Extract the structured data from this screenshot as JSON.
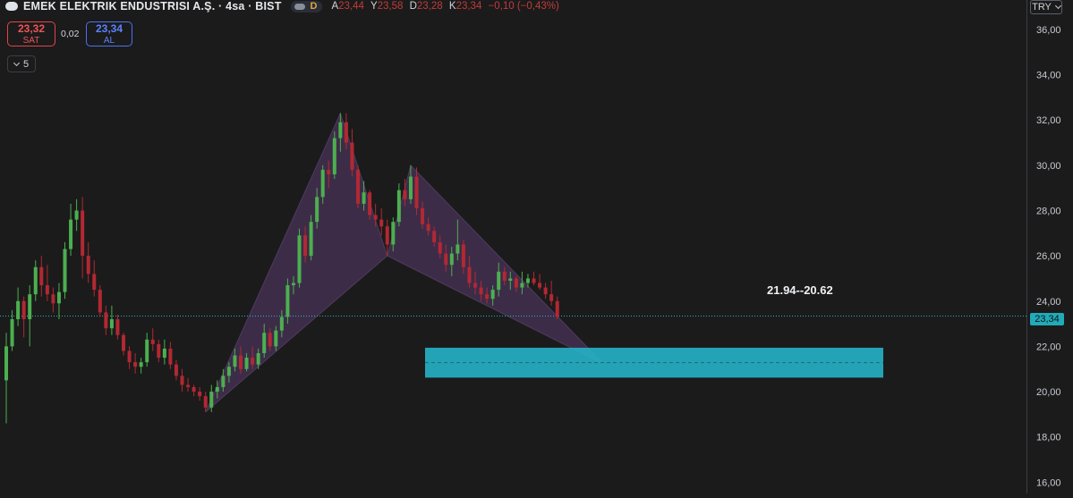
{
  "header": {
    "symbol_title": "EMEK ELEKTRIK ENDUSTRISI A.Ş. · 4sa · BIST",
    "mode_badge": "D",
    "ohlc": [
      {
        "label": "A",
        "value": "23,44"
      },
      {
        "label": "Y",
        "value": "23,58"
      },
      {
        "label": "D",
        "value": "23,28"
      },
      {
        "label": "K",
        "value": "23,34"
      },
      {
        "label": "",
        "value": "−0,10 (−0,43%)"
      }
    ]
  },
  "trade": {
    "sell_price": "23,32",
    "sell_label": "SAT",
    "spread": "0,02",
    "buy_price": "23,34",
    "buy_label": "AL"
  },
  "indicators_collapsed_count": "5",
  "currency": "TRY",
  "last_price_label": "23,34",
  "zone_label": "21.94--20.62",
  "colors": {
    "background": "#1b1b1b",
    "up": "#4caf50",
    "down": "#b22833",
    "pattern_fill": "#5a3a6e",
    "zone": "#26b3c8",
    "last_price_line": "#26b3c8"
  },
  "chart_data": {
    "type": "candlestick",
    "ylim": [
      15.5,
      37.3
    ],
    "y_ticks": [
      "16,00",
      "18,00",
      "20,00",
      "22,00",
      "24,00",
      "26,00",
      "28,00",
      "30,00",
      "32,00",
      "34,00",
      "36,00"
    ],
    "last_price": 23.34,
    "candles": [
      [
        20.5,
        22.6,
        18.6,
        22.0
      ],
      [
        22.0,
        23.6,
        21.8,
        23.2
      ],
      [
        23.2,
        24.6,
        22.9,
        24.0
      ],
      [
        24.0,
        24.2,
        22.4,
        23.2
      ],
      [
        23.2,
        24.7,
        22.0,
        24.3
      ],
      [
        24.3,
        25.8,
        24.0,
        25.5
      ],
      [
        25.5,
        26.0,
        24.2,
        24.7
      ],
      [
        24.7,
        25.6,
        24.0,
        24.3
      ],
      [
        24.3,
        24.6,
        23.5,
        23.9
      ],
      [
        23.9,
        24.8,
        23.2,
        24.4
      ],
      [
        24.4,
        26.6,
        24.1,
        26.3
      ],
      [
        26.3,
        28.3,
        26.0,
        27.6
      ],
      [
        27.6,
        28.5,
        27.1,
        28.0
      ],
      [
        28.0,
        28.6,
        25.0,
        26.0
      ],
      [
        26.0,
        26.6,
        24.8,
        25.2
      ],
      [
        25.2,
        25.8,
        24.2,
        24.5
      ],
      [
        24.5,
        24.7,
        23.3,
        23.5
      ],
      [
        23.5,
        23.8,
        22.5,
        22.8
      ],
      [
        22.8,
        23.8,
        22.5,
        23.2
      ],
      [
        23.2,
        23.4,
        22.3,
        22.5
      ],
      [
        22.5,
        22.6,
        21.6,
        21.8
      ],
      [
        21.8,
        22.0,
        21.0,
        21.3
      ],
      [
        21.3,
        21.7,
        20.8,
        21.1
      ],
      [
        21.1,
        21.5,
        20.8,
        21.3
      ],
      [
        21.3,
        22.6,
        21.1,
        22.3
      ],
      [
        22.3,
        22.8,
        21.8,
        22.1
      ],
      [
        22.1,
        22.3,
        21.3,
        21.5
      ],
      [
        21.5,
        22.3,
        21.2,
        21.9
      ],
      [
        21.9,
        22.2,
        21.0,
        21.2
      ],
      [
        21.2,
        21.4,
        20.5,
        20.7
      ],
      [
        20.7,
        21.0,
        20.0,
        20.3
      ],
      [
        20.3,
        20.6,
        20.0,
        20.2
      ],
      [
        20.2,
        20.3,
        19.8,
        20.0
      ],
      [
        20.0,
        20.2,
        19.6,
        19.8
      ],
      [
        19.8,
        20.0,
        19.1,
        19.3
      ],
      [
        19.3,
        20.3,
        19.1,
        20.0
      ],
      [
        20.0,
        20.5,
        19.7,
        20.2
      ],
      [
        20.2,
        21.0,
        20.0,
        20.7
      ],
      [
        20.7,
        21.3,
        20.4,
        21.1
      ],
      [
        21.1,
        21.9,
        20.9,
        21.6
      ],
      [
        21.6,
        22.0,
        20.8,
        21.0
      ],
      [
        21.0,
        21.7,
        20.9,
        21.5
      ],
      [
        21.5,
        22.0,
        21.0,
        21.2
      ],
      [
        21.2,
        21.9,
        21.0,
        21.7
      ],
      [
        21.7,
        23.0,
        21.5,
        22.6
      ],
      [
        22.6,
        22.8,
        21.8,
        22.0
      ],
      [
        22.0,
        22.9,
        21.8,
        22.7
      ],
      [
        22.7,
        23.6,
        22.4,
        23.3
      ],
      [
        23.3,
        25.0,
        23.0,
        24.7
      ],
      [
        24.7,
        25.1,
        24.3,
        24.8
      ],
      [
        24.8,
        27.2,
        24.6,
        26.9
      ],
      [
        26.9,
        27.3,
        25.7,
        26.0
      ],
      [
        26.0,
        27.8,
        25.8,
        27.5
      ],
      [
        27.5,
        29.0,
        27.2,
        28.6
      ],
      [
        28.6,
        30.0,
        28.3,
        29.8
      ],
      [
        29.8,
        30.2,
        29.0,
        29.6
      ],
      [
        29.6,
        31.5,
        29.4,
        31.2
      ],
      [
        31.2,
        32.3,
        30.6,
        31.9
      ],
      [
        31.9,
        32.3,
        30.7,
        31.0
      ],
      [
        31.0,
        31.6,
        29.5,
        29.8
      ],
      [
        29.8,
        30.0,
        28.1,
        28.3
      ],
      [
        28.3,
        29.3,
        28.0,
        28.8
      ],
      [
        28.8,
        28.9,
        27.6,
        27.8
      ],
      [
        27.8,
        28.3,
        27.3,
        27.6
      ],
      [
        27.6,
        28.1,
        26.9,
        27.3
      ],
      [
        27.3,
        27.6,
        26.0,
        26.5
      ],
      [
        26.5,
        27.7,
        26.2,
        27.5
      ],
      [
        27.5,
        29.2,
        27.3,
        28.9
      ],
      [
        28.9,
        29.4,
        28.2,
        28.5
      ],
      [
        28.5,
        30.0,
        28.3,
        29.5
      ],
      [
        29.5,
        29.9,
        27.8,
        28.1
      ],
      [
        28.1,
        28.4,
        27.2,
        27.4
      ],
      [
        27.4,
        27.7,
        26.9,
        27.1
      ],
      [
        27.1,
        27.3,
        26.4,
        26.6
      ],
      [
        26.6,
        26.9,
        25.9,
        26.1
      ],
      [
        26.1,
        26.5,
        25.3,
        25.6
      ],
      [
        25.6,
        26.4,
        25.1,
        26.1
      ],
      [
        26.1,
        27.6,
        25.8,
        26.5
      ],
      [
        26.5,
        26.7,
        25.2,
        25.5
      ],
      [
        25.5,
        26.0,
        24.6,
        24.8
      ],
      [
        24.8,
        25.3,
        24.3,
        24.6
      ],
      [
        24.6,
        24.9,
        24.0,
        24.3
      ],
      [
        24.3,
        24.6,
        23.9,
        24.1
      ],
      [
        24.1,
        24.7,
        23.8,
        24.5
      ],
      [
        24.5,
        25.7,
        24.2,
        25.3
      ],
      [
        25.3,
        25.5,
        24.7,
        24.9
      ],
      [
        24.9,
        25.3,
        24.5,
        25.0
      ],
      [
        25.0,
        25.1,
        24.4,
        24.6
      ],
      [
        24.6,
        25.3,
        24.3,
        24.8
      ],
      [
        24.8,
        25.2,
        24.6,
        25.0
      ],
      [
        25.0,
        25.3,
        24.7,
        24.8
      ],
      [
        24.8,
        25.2,
        24.5,
        24.6
      ],
      [
        24.6,
        24.8,
        24.1,
        24.3
      ],
      [
        24.3,
        24.9,
        23.8,
        24.0
      ],
      [
        24.0,
        24.2,
        23.2,
        23.3
      ]
    ],
    "harmonic_pattern": {
      "type": "bat",
      "points": [
        {
          "bar": 34,
          "price": 19.1
        },
        {
          "bar": 57,
          "price": 32.3
        },
        {
          "bar": 65,
          "price": 26.0
        },
        {
          "bar": 69,
          "price": 30.0
        },
        {
          "bar": 102,
          "price": 21.2
        }
      ]
    },
    "target_zone": {
      "top": 21.94,
      "bottom": 20.62
    }
  }
}
